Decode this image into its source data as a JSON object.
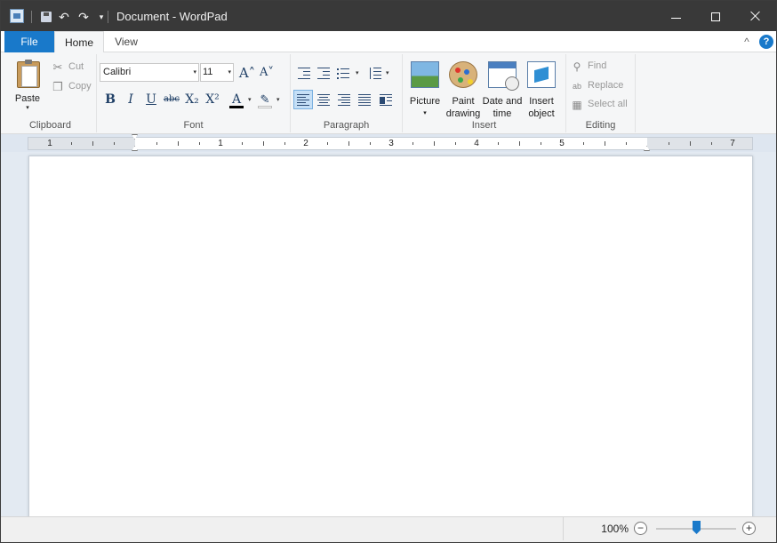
{
  "window": {
    "title": "Document - WordPad"
  },
  "quick_access": {
    "save_icon": "save-icon",
    "undo_glyph": "↶",
    "redo_glyph": "↷",
    "more_glyph": "▾"
  },
  "ribbon_tabs": {
    "file": "File",
    "home": "Home",
    "view": "View",
    "collapse_glyph": "^",
    "help_glyph": "?"
  },
  "clipboard": {
    "group_label": "Clipboard",
    "paste": "Paste",
    "cut": "Cut",
    "copy": "Copy",
    "cut_glyph": "✂",
    "copy_glyph": "❐",
    "arrow_glyph": "▾"
  },
  "font": {
    "group_label": "Font",
    "family": "Calibri",
    "size": "11",
    "dropdown_glyph": "▾",
    "grow_glyph": "A˄",
    "shrink_glyph": "A˅",
    "bold": "B",
    "italic": "I",
    "underline": "U",
    "strikethrough": "abc",
    "subscript": "X₂",
    "superscript": "X²",
    "font_color_glyph": "A",
    "highlight_glyph": "✎"
  },
  "paragraph": {
    "group_label": "Paragraph",
    "dropdown_glyph": "▾"
  },
  "insert": {
    "group_label": "Insert",
    "picture": "Picture",
    "paint_drawing_line1": "Paint",
    "paint_drawing_line2": "drawing",
    "date_time_line1": "Date and",
    "date_time_line2": "time",
    "insert_object_line1": "Insert",
    "insert_object_line2": "object",
    "arrow_glyph": "▾"
  },
  "editing": {
    "group_label": "Editing",
    "find": "Find",
    "replace": "Replace",
    "select_all": "Select all",
    "find_glyph": "⚲",
    "replace_glyph": "ab",
    "select_all_glyph": "▦"
  },
  "ruler": {
    "numbers": [
      "1",
      "1",
      "2",
      "3",
      "4",
      "5",
      "7"
    ]
  },
  "status": {
    "zoom": "100%",
    "zoom_out_glyph": "−",
    "zoom_in_glyph": "+",
    "zoom_fraction": 0.5
  },
  "colors": {
    "accent": "#1979ca",
    "titlebar": "#393939"
  }
}
